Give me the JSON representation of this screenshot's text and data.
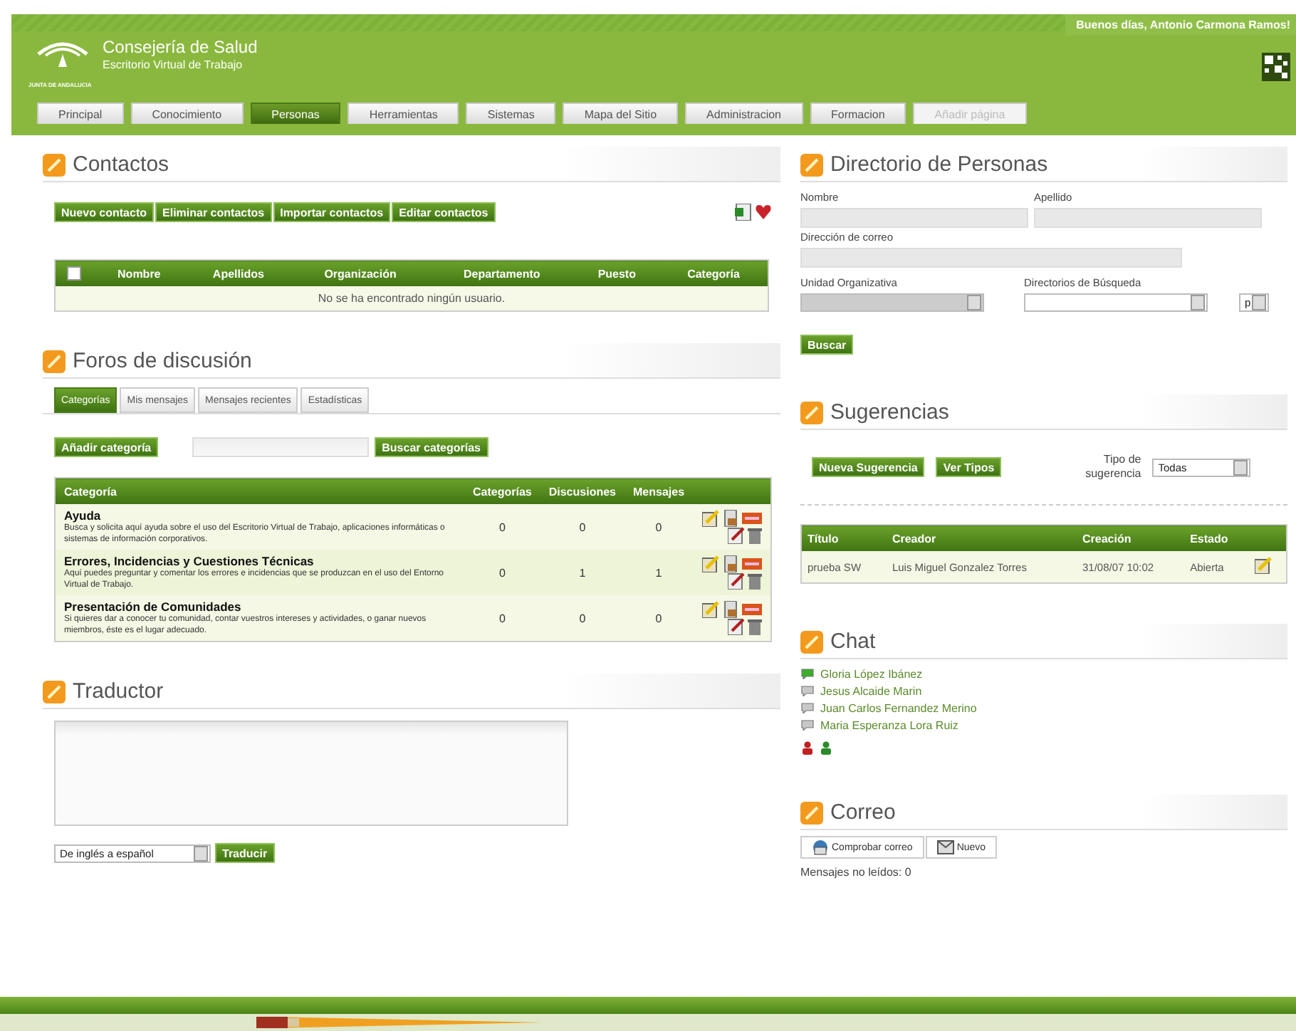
{
  "header": {
    "title": "Consejería de Salud",
    "subtitle": "Escritorio Virtual de Trabajo",
    "logo_caption": "JUNTA DE ANDALUCIA",
    "greeting": "Buenos días, Antonio Carmona Ramos!"
  },
  "nav": [
    {
      "label": "Principal",
      "selected": false,
      "disabled": false
    },
    {
      "label": "Conocimiento",
      "selected": false,
      "disabled": false
    },
    {
      "label": "Personas",
      "selected": true,
      "disabled": false
    },
    {
      "label": "Herramientas",
      "selected": false,
      "disabled": false
    },
    {
      "label": "Sistemas",
      "selected": false,
      "disabled": false
    },
    {
      "label": "Mapa del Sitio",
      "selected": false,
      "disabled": false
    },
    {
      "label": "Administracion",
      "selected": false,
      "disabled": false
    },
    {
      "label": "Formacion",
      "selected": false,
      "disabled": false
    },
    {
      "label": "Añadir página",
      "selected": false,
      "disabled": true
    }
  ],
  "contactos": {
    "title": "Contactos",
    "buttons": [
      "Nuevo contacto",
      "Eliminar contactos",
      "Importar contactos",
      "Editar contactos"
    ],
    "columns": [
      "Nombre",
      "Apellidos",
      "Organización",
      "Departamento",
      "Puesto",
      "Categoría"
    ],
    "select_all": false,
    "empty_message": "No se ha encontrado ningún usuario."
  },
  "foros": {
    "title": "Foros de discusión",
    "tabs": [
      {
        "label": "Categorías",
        "selected": true
      },
      {
        "label": "Mis mensajes",
        "selected": false
      },
      {
        "label": "Mensajes recientes",
        "selected": false
      },
      {
        "label": "Estadísticas",
        "selected": false
      }
    ],
    "add_button": "Añadir categoría",
    "search_button": "Buscar categorías",
    "columns": [
      "Categoría",
      "Categorías",
      "Discusiones",
      "Mensajes"
    ],
    "rows": [
      {
        "title": "Ayuda",
        "description": "Busca y solicita aquí ayuda sobre el uso del Escritorio Virtual de Trabajo, aplicaciones informáticas o sistemas de información corporativos.",
        "categorias": "0",
        "discusiones": "0",
        "mensajes": "0"
      },
      {
        "title": "Errores, Incidencias y Cuestiones Técnicas",
        "description": "Aquí puedes preguntar y comentar los errores e incidencias que se produzcan en el uso del Entorno Virtual de Trabajo.",
        "categorias": "0",
        "discusiones": "1",
        "mensajes": "1"
      },
      {
        "title": "Presentación de Comunidades",
        "description": "Si quieres dar a conocer tu comunidad, contar vuestros intereses y actividades, o ganar nuevos miembros, éste es el lugar adecuado.",
        "categorias": "0",
        "discusiones": "0",
        "mensajes": "0"
      }
    ]
  },
  "traductor": {
    "title": "Traductor",
    "language": "De inglés a español",
    "button": "Traducir"
  },
  "directorio": {
    "title": "Directorio de Personas",
    "labels": [
      "Nombre",
      "Apellido",
      "Dirección de correo",
      "Unidad Organizativa",
      "Directorios de Búsqueda"
    ],
    "small_select": "p",
    "button": "Buscar"
  },
  "sugerencias": {
    "title": "Sugerencias",
    "buttons": [
      "Nueva Sugerencia",
      "Ver Tipos"
    ],
    "filter_label": "Tipo de sugerencia",
    "filter_value": "Todas",
    "columns": [
      "Título",
      "Creador",
      "Creación",
      "Estado"
    ],
    "rows": [
      {
        "titulo": "prueba SW",
        "creador": "Luis Miguel Gonzalez Torres",
        "creacion": "31/08/07 10:02",
        "estado": "Abierta"
      }
    ]
  },
  "chat": {
    "title": "Chat",
    "users": [
      {
        "name": "Gloria López Ibánez",
        "online": true
      },
      {
        "name": "Jesus Alcaide Marin",
        "online": false
      },
      {
        "name": "Juan Carlos Fernandez Merino",
        "online": false
      },
      {
        "name": "Maria Esperanza Lora Ruiz",
        "online": false
      }
    ]
  },
  "correo": {
    "title": "Correo",
    "buttons": [
      "Comprobar correo",
      "Nuevo"
    ],
    "unread": "Mensajes no leídos: 0"
  }
}
